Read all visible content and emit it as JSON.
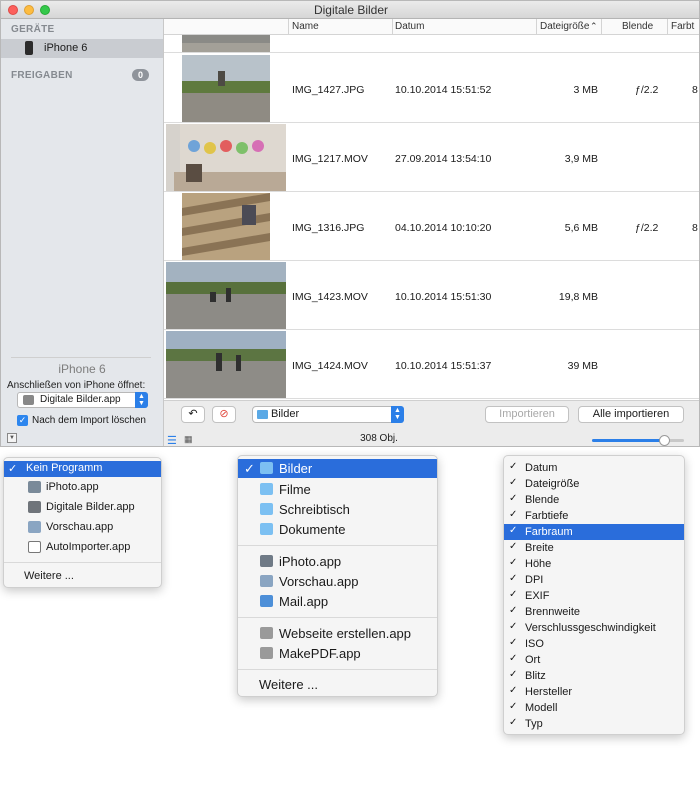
{
  "window": {
    "title": "Digitale Bilder"
  },
  "sidebar": {
    "devices_header": "GERÄTE",
    "device_name": "iPhone 6",
    "shares_header": "FREIGABEN",
    "shares_count": "0",
    "device_caption": "iPhone 6",
    "open_with_label": "Anschließen von iPhone öffnet:",
    "open_with_value": "Digitale Bilder.app",
    "delete_after_import_label": "Nach dem Import löschen",
    "delete_after_import_checked": true
  },
  "table": {
    "columns": [
      "Name",
      "Datum",
      "Dateigröße",
      "Blende",
      "Farbt"
    ],
    "sort_indicator": "⌃",
    "rows": [
      {
        "name": "IMG_1427.JPG",
        "date": "10.10.2014 15:51:52",
        "size": "3 MB",
        "aperture": "ƒ/2.2",
        "extra": "8"
      },
      {
        "name": "IMG_1217.MOV",
        "date": "27.09.2014 13:54:10",
        "size": "3,9 MB",
        "aperture": "",
        "extra": ""
      },
      {
        "name": "IMG_1316.JPG",
        "date": "04.10.2014 10:10:20",
        "size": "5,6 MB",
        "aperture": "ƒ/2.2",
        "extra": "8"
      },
      {
        "name": "IMG_1423.MOV",
        "date": "10.10.2014 15:51:30",
        "size": "19,8 MB",
        "aperture": "",
        "extra": ""
      },
      {
        "name": "IMG_1424.MOV",
        "date": "10.10.2014 15:51:37",
        "size": "39 MB",
        "aperture": "",
        "extra": ""
      }
    ]
  },
  "toolbar": {
    "folder_value": "Bilder",
    "import_label": "Importieren",
    "import_all_label": "Alle importieren",
    "item_count": "308 Obj.",
    "thumbnail_size": 0.78
  },
  "menu_app": {
    "items": [
      "Kein Programm",
      "iPhoto.app",
      "Digitale Bilder.app",
      "Vorschau.app",
      "AutoImporter.app"
    ],
    "selected": "Kein Programm",
    "other": "Weitere ..."
  },
  "menu_folder": {
    "folders": [
      "Bilder",
      "Filme",
      "Schreibtisch",
      "Dokumente"
    ],
    "apps": [
      "iPhoto.app",
      "Vorschau.app",
      "Mail.app"
    ],
    "workflows": [
      "Webseite erstellen.app",
      "MakePDF.app"
    ],
    "selected": "Bilder",
    "other": "Weitere ..."
  },
  "menu_columns": {
    "items": [
      "Datum",
      "Dateigröße",
      "Blende",
      "Farbtiefe",
      "Farbraum",
      "Breite",
      "Höhe",
      "DPI",
      "EXIF",
      "Brennweite",
      "Verschlussgeschwindigkeit",
      "ISO",
      "Ort",
      "Blitz",
      "Hersteller",
      "Modell",
      "Typ"
    ],
    "selected": "Farbraum"
  },
  "colors": {
    "accent": "#2a6ddb",
    "sidebar_bg": "#e4e7eb"
  }
}
